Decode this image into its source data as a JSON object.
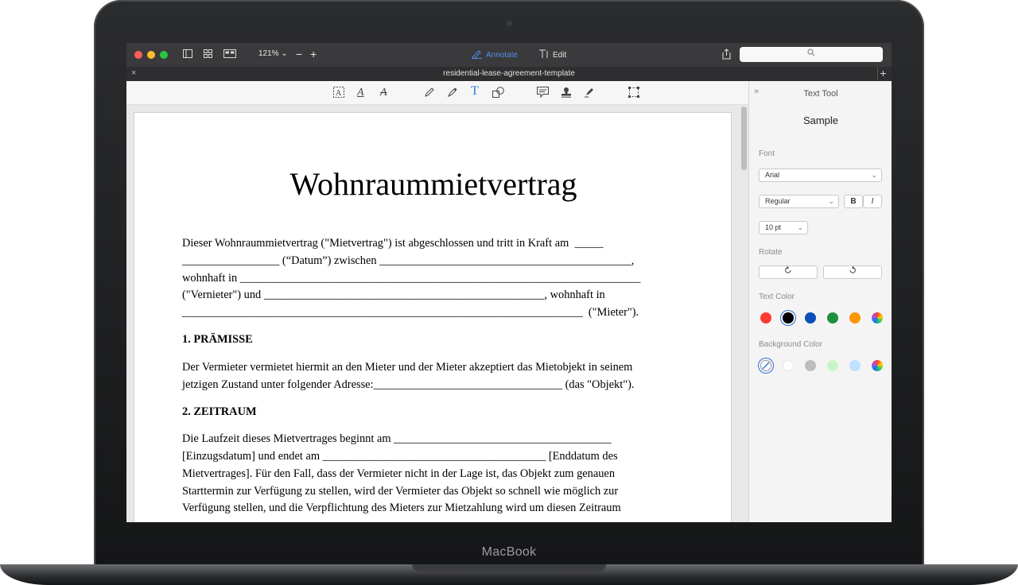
{
  "device": {
    "brand_label": "MacBook"
  },
  "window": {
    "zoom_label": "121%",
    "modes": [
      {
        "label": "Annotate",
        "active": true
      },
      {
        "label": "Edit",
        "active": false
      }
    ],
    "tab_title": "residential-lease-agreement-template"
  },
  "document": {
    "title": "Wohnraummietvertrag",
    "intro": [
      "Dieser Wohnraummietvertrag (\"Mietvertrag\") ist abgeschlossen und tritt in Kraft am  _____",
      "_________________ (“Datum”) zwischen ____________________________________________,",
      "wohnhaft in ______________________________________________________________________",
      "(\"Vernieter\") und _________________________________________________, wohnhaft in",
      "______________________________________________________________________  (\"Mieter\")."
    ],
    "section1": {
      "heading": "1. PRÄMISSE",
      "lines": [
        "Der Vermieter vermietet hiermit an den Mieter und der Mieter akzeptiert das Mietobjekt in seinem",
        "jetzigen Zustand unter folgender Adresse:_________________________________ (das \"Objekt\")."
      ]
    },
    "section2": {
      "heading": "2. ZEITRAUM",
      "lines": [
        "Die Laufzeit dieses Mietvertrages beginnt am ______________________________________",
        "[Einzugsdatum] und endet am _______________________________________ [Enddatum des",
        "Mietvertrages]. Für den Fall, dass der Vermieter nicht in der Lage ist, das Objekt zum genauen",
        "Starttermin zur Verfügung zu stellen, wird der Vermieter das Objekt so schnell wie möglich zur",
        "Verfügung stellen, und die Verpflichtung des Mieters zur Mietzahlung wird um diesen Zeitraum"
      ]
    }
  },
  "inspector": {
    "title": "Text Tool",
    "sample": "Sample",
    "font_label": "Font",
    "font_value": "Arial",
    "style_value": "Regular",
    "bold_label": "B",
    "italic_label": "I",
    "size_value": "10 pt",
    "rotate_label": "Rotate",
    "text_color_label": "Text Color",
    "background_color_label": "Background Color",
    "text_colors": [
      "#ff3b30",
      "#000000",
      "#0a4fb5",
      "#1e8f3e",
      "#ff9500",
      "multicolor"
    ],
    "text_color_selected": "#000000",
    "background_colors": [
      "none",
      "#ffffff",
      "#bdbdbd",
      "#c8f5c8",
      "#bfe0ff",
      "multicolor"
    ],
    "background_color_selected": "none"
  },
  "icons": {
    "titlebar": [
      "sidebar-icon",
      "thumbnails-icon",
      "two-page-icon",
      "zoom-out-icon",
      "zoom-in-icon",
      "annotate-pen-icon",
      "edit-text-icon",
      "share-icon",
      "search-icon"
    ],
    "annotation_toolbar": [
      "text-box-icon",
      "underline-text-icon",
      "strikethrough-text-icon",
      "pencil-icon",
      "highlighter-icon",
      "text-tool-icon",
      "shapes-icon",
      "note-icon",
      "stamp-icon",
      "signature-pen-icon",
      "selection-icon"
    ]
  }
}
